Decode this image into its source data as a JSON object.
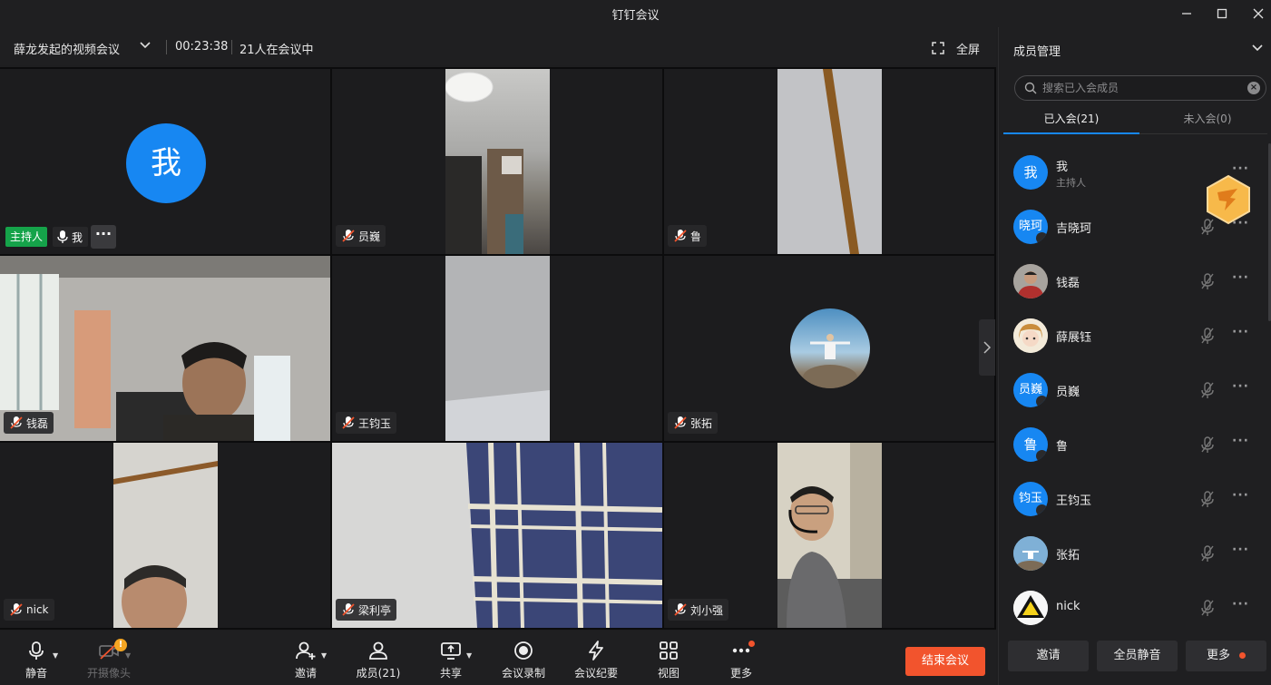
{
  "window": {
    "title": "钉钉会议"
  },
  "meeting": {
    "title": "薛龙发起的视频会议",
    "timer": "00:23:38",
    "participants_status": "21人在会议中",
    "fullscreen_label": "全屏"
  },
  "tiles": [
    {
      "name": "我",
      "avatar_text": "我",
      "host_label": "主持人"
    },
    {
      "name": "员巍"
    },
    {
      "name": "鲁"
    },
    {
      "name": "钱磊"
    },
    {
      "name": "王钧玉"
    },
    {
      "name": "张拓"
    },
    {
      "name": "nick"
    },
    {
      "name": "梁利亭"
    },
    {
      "name": "刘小强"
    }
  ],
  "toolbar": {
    "mute": "静音",
    "camera": "开摄像头",
    "invite": "邀请",
    "members": "成员(21)",
    "share": "共享",
    "record": "会议录制",
    "minutes": "会议纪要",
    "view": "视图",
    "more": "更多",
    "end": "结束会议",
    "camera_warning": "!"
  },
  "panel": {
    "title": "成员管理",
    "search_placeholder": "搜索已入会成员",
    "tab_joined": "已入会(21)",
    "tab_not_joined": "未入会(0)",
    "members": [
      {
        "name": "我",
        "avatar_text": "我",
        "sub": "主持人"
      },
      {
        "name": "吉晓珂",
        "avatar_text": "晓珂"
      },
      {
        "name": "钱磊",
        "avatar_text": ""
      },
      {
        "name": "薛展钰",
        "avatar_text": ""
      },
      {
        "name": "员巍",
        "avatar_text": "员巍"
      },
      {
        "name": "鲁",
        "avatar_text": "鲁"
      },
      {
        "name": "王钧玉",
        "avatar_text": "钧玉"
      },
      {
        "name": "张拓",
        "avatar_text": ""
      },
      {
        "name": "nick",
        "avatar_text": ""
      }
    ],
    "btn_invite": "邀请",
    "btn_mute_all": "全员静音",
    "btn_more": "更多"
  },
  "colors": {
    "accent": "#1787f2",
    "end_button": "#f2542d",
    "host_badge": "#15a34a"
  }
}
